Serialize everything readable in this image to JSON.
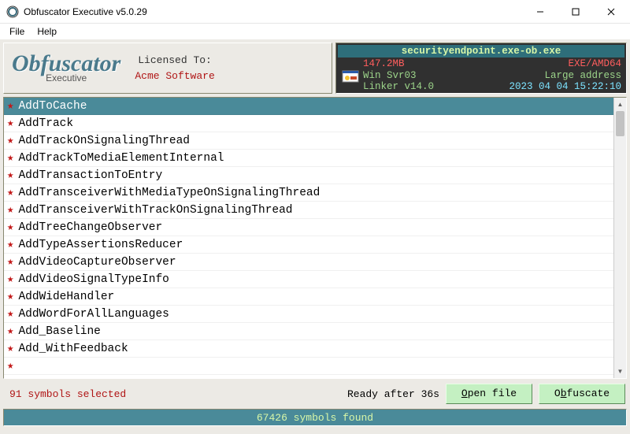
{
  "window": {
    "title": "Obfuscator Executive v5.0.29"
  },
  "menu": {
    "file": "File",
    "help": "Help"
  },
  "logo": {
    "main": "Obfuscator",
    "sub": "Executive"
  },
  "license": {
    "label": "Licensed To:",
    "company": "Acme Software"
  },
  "info": {
    "filename": "securityendpoint.exe-ob.exe",
    "size": "147.2MB",
    "arch": "EXE/AMD64",
    "os": "Win Svr03",
    "flag": "Large address",
    "linker": "Linker v14.0",
    "timestamp": "2023 04 04 15:22:10"
  },
  "symbols": [
    "AddToCache",
    "AddTrack",
    "AddTrackOnSignalingThread",
    "AddTrackToMediaElementInternal",
    "AddTransactionToEntry",
    "AddTransceiverWithMediaTypeOnSignalingThread",
    "AddTransceiverWithTrackOnSignalingThread",
    "AddTreeChangeObserver",
    "AddTypeAssertionsReducer",
    "AddVideoCaptureObserver",
    "AddVideoSignalTypeInfo",
    "AddWideHandler",
    "AddWordForAllLanguages",
    "Add_Baseline",
    "Add_WithFeedback"
  ],
  "status": {
    "selected": "91 symbols selected",
    "ready": "Ready after 36s"
  },
  "buttons": {
    "open": "Open file",
    "open_u": "O",
    "obfuscate": "Obfuscate",
    "obfuscate_u": "b"
  },
  "footer": "67426 symbols found"
}
